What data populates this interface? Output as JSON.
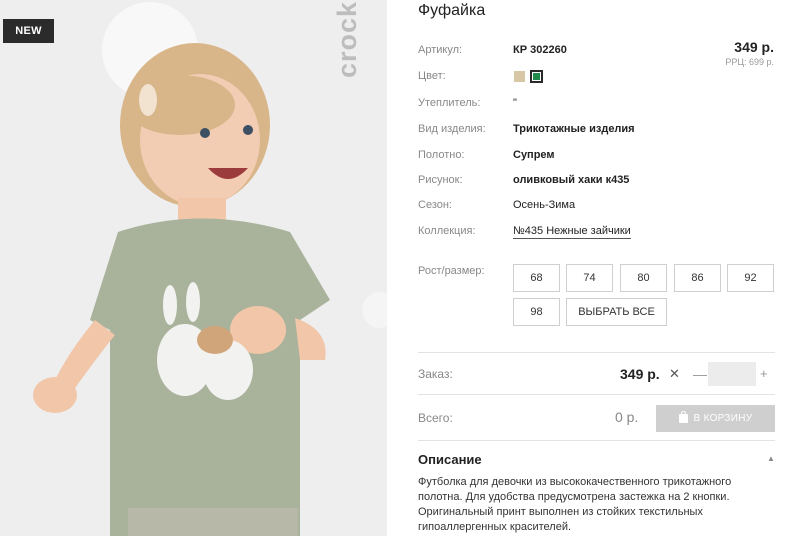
{
  "image": {
    "badge": "NEW",
    "logo_text": "crockid"
  },
  "product": {
    "title": "Фуфайка",
    "price": "349 р.",
    "rrp": "РРЦ: 699 р."
  },
  "specs": {
    "article_label": "Артикул:",
    "article_value": "КР 302260",
    "color_label": "Цвет:",
    "colors": [
      "#d8c7a5",
      "#1f8a4c"
    ],
    "insulation_label": "Утеплитель:",
    "insulation_value": "\"",
    "type_label": "Вид изделия:",
    "type_value": "Трикотажные изделия",
    "fabric_label": "Полотно:",
    "fabric_value": "Супрем",
    "print_label": "Рисунок:",
    "print_value": "оливковый хаки к435",
    "season_label": "Сезон:",
    "season_value": "Осень-Зима",
    "collection_label": "Коллекция:",
    "collection_value": "№435 Нежные зайчики"
  },
  "sizes": {
    "label": "Рост/размер:",
    "options": [
      "68",
      "74",
      "80",
      "86",
      "92",
      "98"
    ],
    "select_all": "ВЫБРАТЬ ВСЕ"
  },
  "order": {
    "label": "Заказ:",
    "price": "349 р.",
    "times": "✕",
    "minus": "—",
    "quantity": "",
    "plus": "+"
  },
  "total": {
    "label": "Всего:",
    "value": "0 р.",
    "cart_button": "В КОРЗИНУ"
  },
  "description": {
    "title": "Описание",
    "toggle": "▲",
    "text": "Футболка для девочки из высококачественного трикотажного полотна. Для удобства предусмотрена застежка на 2 кнопки. Оригинальный принт выполнен из стойких текстильных гипоаллергенных красителей."
  }
}
